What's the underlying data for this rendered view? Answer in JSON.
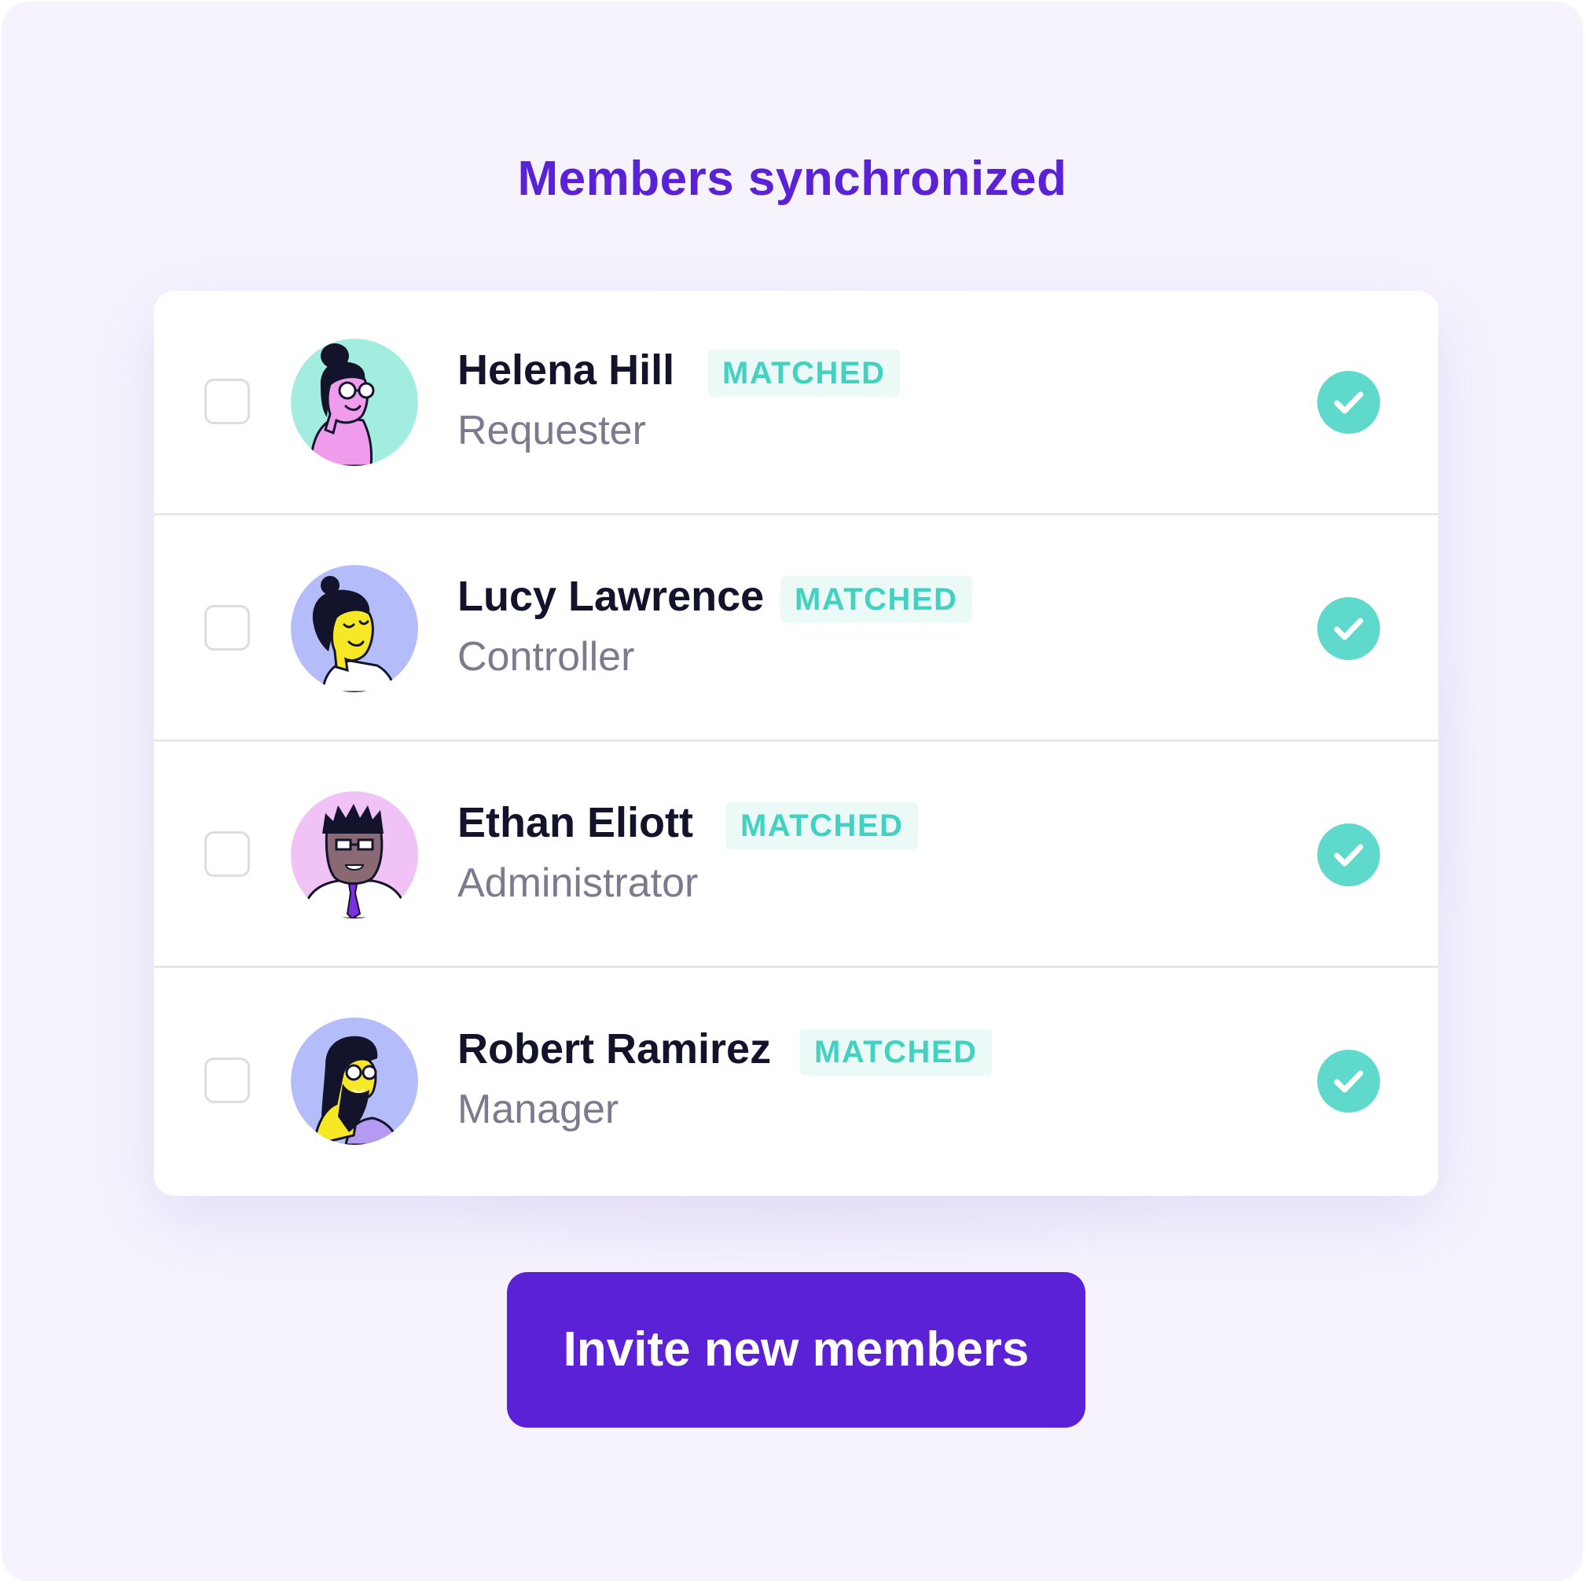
{
  "page": {
    "title": "Members synchronized",
    "accent_color": "#5b21d6",
    "matched_color": "#43d2c1",
    "background_color": "#f6f3fd"
  },
  "members": [
    {
      "name": "Helena Hill",
      "status": "MATCHED",
      "role": "Requester",
      "avatar_bg": "#a3ece0",
      "selected": false,
      "synced": true,
      "icon": "check-circle-icon"
    },
    {
      "name": "Lucy Lawrence",
      "status": "MATCHED",
      "role": "Controller",
      "avatar_bg": "#b4bdfa",
      "selected": false,
      "synced": true,
      "icon": "check-circle-icon"
    },
    {
      "name": "Ethan Eliott",
      "status": "MATCHED",
      "role": "Administrator",
      "avatar_bg": "#f0c2f6",
      "selected": false,
      "synced": true,
      "icon": "check-circle-icon"
    },
    {
      "name": "Robert Ramirez",
      "status": "MATCHED",
      "role": "Manager",
      "avatar_bg": "#b4bdfa",
      "selected": false,
      "synced": true,
      "icon": "check-circle-icon"
    }
  ],
  "actions": {
    "invite_label": "Invite new members"
  }
}
